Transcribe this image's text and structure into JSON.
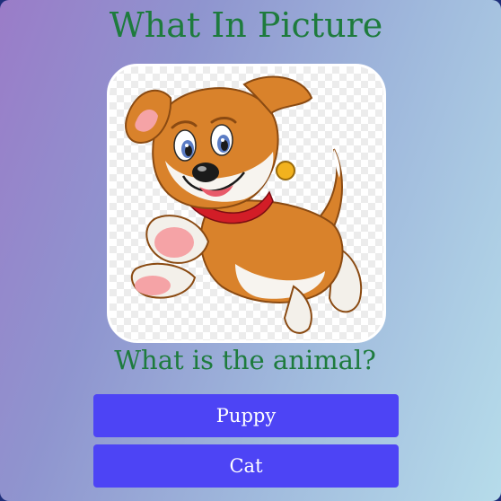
{
  "app": {
    "title": "What In Picture",
    "question": "What is the animal?",
    "picture_icon": "puppy-illustration"
  },
  "answers": [
    {
      "label": "Puppy"
    },
    {
      "label": "Cat"
    }
  ],
  "colors": {
    "title_text": "#1e7b3d",
    "button_bg": "#4d44f5",
    "button_text": "#ffffff"
  }
}
